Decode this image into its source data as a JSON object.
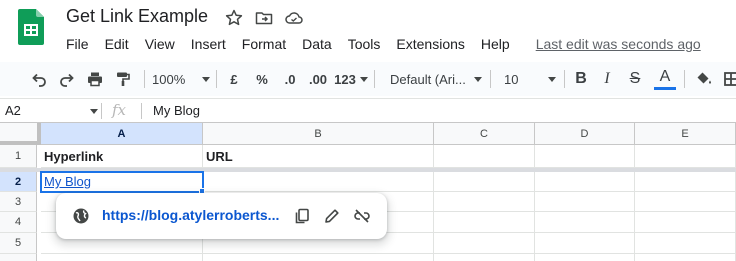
{
  "app": {
    "doc_title": "Get Link Example",
    "last_edit": "Last edit was seconds ago",
    "brand_color": "#0f9d58"
  },
  "menu": [
    "File",
    "Edit",
    "View",
    "Insert",
    "Format",
    "Data",
    "Tools",
    "Extensions",
    "Help"
  ],
  "toolbar": {
    "zoom": "100%",
    "currency": "£",
    "percent": "%",
    "decrease_decimals": ".0",
    "increase_decimals": ".00",
    "more_formats": "123",
    "font_family": "Default (Ari...",
    "font_size": "10",
    "bold": "B",
    "italic": "I",
    "strikethrough": "S",
    "text_color_label": "A",
    "text_color": "#1a73e8"
  },
  "formula_bar": {
    "cell_ref": "A2",
    "fx": "fx",
    "value": "My Blog"
  },
  "columns": [
    "A",
    "B",
    "C",
    "D",
    "E"
  ],
  "rows": [
    "1",
    "2",
    "3",
    "4",
    "5"
  ],
  "cells": {
    "A1": "Hyperlink",
    "B1": "URL",
    "A2": "My Blog"
  },
  "selected": {
    "cell": "A2",
    "column": "A",
    "row": "2"
  },
  "link_chip": {
    "url": "https://blog.atylerroberts...",
    "icons": [
      "globe-icon",
      "copy-icon",
      "edit-icon",
      "remove-link-icon"
    ]
  }
}
